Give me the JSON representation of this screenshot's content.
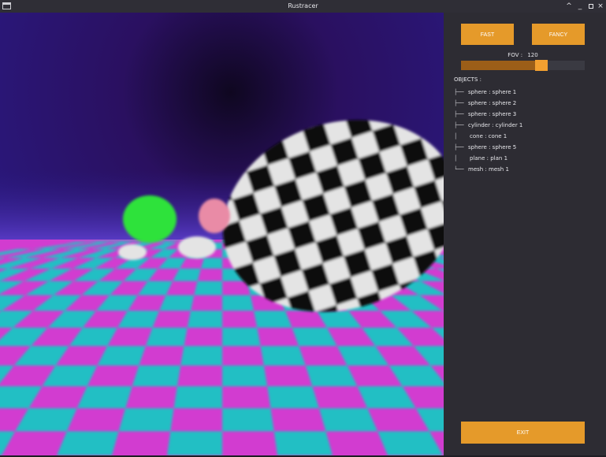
{
  "window": {
    "title": "Rustracer",
    "icons": [
      "app-window-icon",
      "chevron-up-icon",
      "minimize-icon",
      "maximize-icon",
      "close-icon"
    ],
    "controls": {
      "up": "^",
      "minimize": "_",
      "close": "×"
    }
  },
  "panel": {
    "fast_label": "FAST",
    "fancy_label": "FANCY",
    "fov": {
      "label": "FOV :",
      "value": "120",
      "level": 0.67
    },
    "objects_heading": "OBJECTS :",
    "objects": [
      {
        "branch": "├──",
        "label": "sphere : sphere 1"
      },
      {
        "branch": "├──",
        "label": "sphere : sphere 2"
      },
      {
        "branch": "├──",
        "label": "sphere : sphere 3"
      },
      {
        "branch": "├──",
        "label": "cylinder : cylinder 1"
      },
      {
        "branch": "│",
        "label": "cone : cone 1"
      },
      {
        "branch": "├──",
        "label": "sphere : sphere 5"
      },
      {
        "branch": "│",
        "label": "plane : plan 1"
      },
      {
        "branch": "└──",
        "label": "mesh : mesh 1"
      }
    ],
    "exit_label": "EXIT"
  },
  "render": {
    "sky_top": "#2a1060",
    "sky_mid": "#2a1a84",
    "horizon_color": "#5a3cc8",
    "floor_magenta": "#d23cd0",
    "floor_cyan": "#22bfc4",
    "sphere_white": "#e4e4e4",
    "sphere_black": "#111111",
    "small_sphere_green": "#2fe23a",
    "small_sphere_pink": "#e98ba6"
  },
  "colors": {
    "accent": "#e59a2a",
    "panel_bg": "#2d2c33",
    "text": "#e6e6ea"
  }
}
